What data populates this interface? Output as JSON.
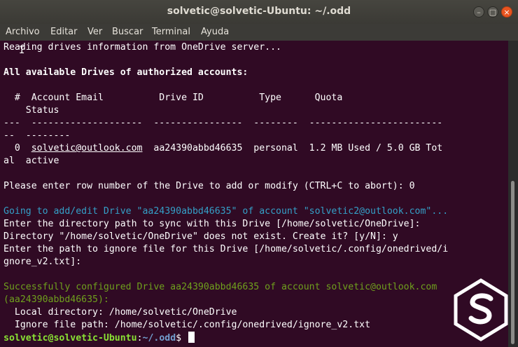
{
  "window": {
    "title": "solvetic@solvetic-Ubuntu: ~/.odd",
    "buttons": {
      "minimize": "–",
      "maximize": "□",
      "close": "×"
    }
  },
  "menu": {
    "items": [
      "Archivo",
      "Editar",
      "Ver",
      "Buscar",
      "Terminal",
      "Ayuda"
    ]
  },
  "terminal": {
    "lines": {
      "l1": "Reading drives information from OneDrive server...",
      "l2": "All available Drives of authorized accounts:",
      "l3": "  #  Account Email          Drive ID          Type      Quota",
      "l4": "    Status",
      "l5": "---  --------------------  ----------------  --------  ------------------------",
      "l6": "--  --------",
      "l7a": "  0  ",
      "l7email": "solvetic@outlook.com",
      "l7b": "  aa24390abbd46635  personal  1.2 MB Used / 5.0 GB Tot",
      "l8": "al  active",
      "l9": "Please enter row number of the Drive to add or modify (CTRL+C to abort): 0",
      "l10": "Going to add/edit Drive \"aa24390abbd46635\" of account \"solvetic2@outlook.com\"...",
      "l11": "Enter the directory path to sync with this Drive [/home/solvetic/OneDrive]:",
      "l12": "Directory \"/home/solvetic/OneDrive\" does not exist. Create it? [y/N]: y",
      "l13": "Enter the path to ignore file for this Drive [/home/solvetic/.config/onedrived/i",
      "l14": "gnore_v2.txt]:",
      "l15": "Successfully configured Drive aa24390abbd46635 of account solvetic@outlook.com",
      "l16": "(aa24390abbd46635):",
      "l17": "  Local directory: /home/solvetic/OneDrive",
      "l18": "  Ignore file path: /home/solvetic/.config/onedrived/ignore_v2.txt"
    },
    "prompt": {
      "user_host": "solvetic@solvetic-Ubuntu",
      "sep": ":",
      "path": "~/.odd",
      "symbol": "$ "
    }
  },
  "icons": {
    "logo": "solvetic-logo-icon"
  },
  "colors": {
    "background": "#300a24",
    "info": "#34a0c8",
    "success": "#6fa01d",
    "prompt_user": "#8ae234",
    "prompt_path": "#729fcf",
    "close_button": "#e95420"
  }
}
